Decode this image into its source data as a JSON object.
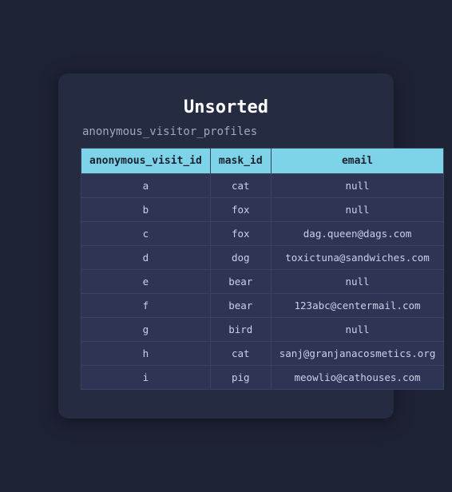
{
  "title": "Unsorted",
  "subtitle": "anonymous_visitor_profiles",
  "table": {
    "columns": [
      {
        "key": "anonymous_visit_id",
        "label": "anonymous_visit_id"
      },
      {
        "key": "mask_id",
        "label": "mask_id"
      },
      {
        "key": "email",
        "label": "email"
      }
    ],
    "rows": [
      {
        "anonymous_visit_id": "a",
        "mask_id": "cat",
        "email": "null"
      },
      {
        "anonymous_visit_id": "b",
        "mask_id": "fox",
        "email": "null"
      },
      {
        "anonymous_visit_id": "c",
        "mask_id": "fox",
        "email": "dag.queen@dags.com"
      },
      {
        "anonymous_visit_id": "d",
        "mask_id": "dog",
        "email": "toxictuna@sandwiches.com"
      },
      {
        "anonymous_visit_id": "e",
        "mask_id": "bear",
        "email": "null"
      },
      {
        "anonymous_visit_id": "f",
        "mask_id": "bear",
        "email": "123abc@centermail.com"
      },
      {
        "anonymous_visit_id": "g",
        "mask_id": "bird",
        "email": "null"
      },
      {
        "anonymous_visit_id": "h",
        "mask_id": "cat",
        "email": "sanj@granjanacosmetics.org"
      },
      {
        "anonymous_visit_id": "i",
        "mask_id": "pig",
        "email": "meowlio@cathouses.com"
      }
    ]
  }
}
